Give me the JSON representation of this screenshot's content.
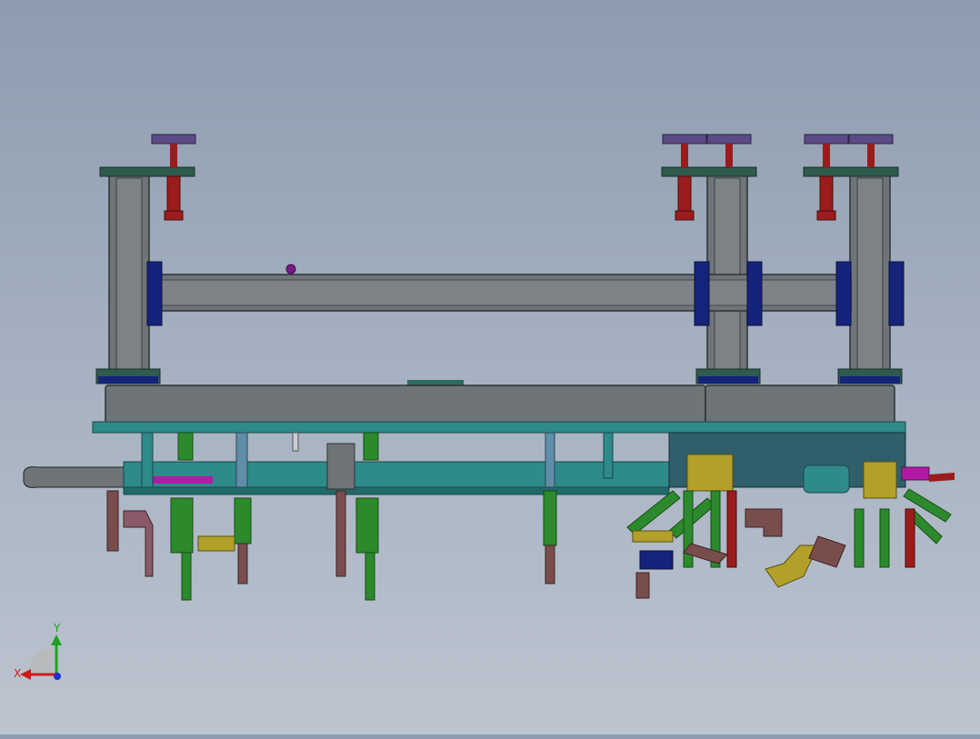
{
  "view": {
    "background_top": "#8d9cb0",
    "background_bottom": "#bcc4cf"
  },
  "triad": {
    "x_label": "X",
    "y_label": "Y",
    "x_color": "#d11a1a",
    "y_color": "#1ea11e",
    "z_color": "#1a2fd1"
  },
  "colors": {
    "frame_gray": "#6f7478",
    "frame_dark": "#3f4447",
    "plate_green": "#2f5a4e",
    "cylinder_red": "#9b1c1c",
    "cap_purple": "#5b4a86",
    "mount_blue": "#15237a",
    "rail_teal": "#2f8a8a",
    "clamp_green": "#2c8a2c",
    "bracket_yellow": "#b3a02a",
    "arm_brown": "#7a4d4d",
    "magenta": "#b21aa6"
  }
}
